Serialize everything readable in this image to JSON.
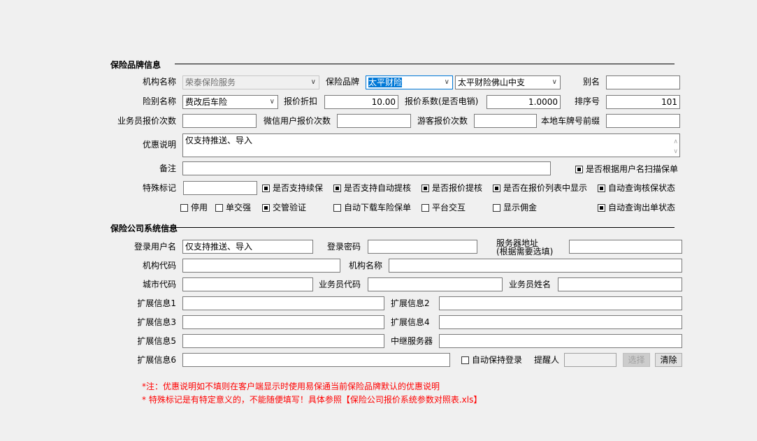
{
  "brand_section": {
    "title": "保险品牌信息",
    "org_name_label": "机构名称",
    "org_name_value": "荣泰保险服务",
    "brand_label": "保险品牌",
    "brand_value": "太平财险",
    "branch_value": "太平财险佛山中支",
    "alias_label": "别名",
    "alias_value": "",
    "insurance_type_label": "险别名称",
    "insurance_type_value": "费改后车险",
    "discount_label": "报价折扣",
    "discount_value": "10.00",
    "coef_label": "报价系数(是否电销)",
    "coef_value": "1.0000",
    "sort_label": "排序号",
    "sort_value": "101",
    "agent_count_label": "业务员报价次数",
    "wechat_count_label": "微信用户报价次数",
    "guest_count_label": "游客报价次数",
    "plate_prefix_label": "本地车牌号前缀",
    "promo_label": "优惠说明",
    "promo_value": "仅支持推送、导入",
    "remark_label": "备注",
    "special_label": "特殊标记",
    "checkboxes": [
      {
        "label": "是否根据用户名扫描保单",
        "checked": true
      },
      {
        "label": "是否支持续保",
        "checked": true
      },
      {
        "label": "是否支持自动提核",
        "checked": true
      },
      {
        "label": "是否报价提核",
        "checked": true
      },
      {
        "label": "是否在报价列表中显示",
        "checked": true
      },
      {
        "label": "自动查询核保状态",
        "checked": true
      },
      {
        "label": "停用",
        "checked": false
      },
      {
        "label": "单交强",
        "checked": false
      },
      {
        "label": "交管验证",
        "checked": true
      },
      {
        "label": "自动下载车险保单",
        "checked": false
      },
      {
        "label": "平台交互",
        "checked": false
      },
      {
        "label": "显示佣金",
        "checked": false
      },
      {
        "label": "自动查询出单状态",
        "checked": true
      }
    ]
  },
  "system_section": {
    "title": "保险公司系统信息",
    "login_user_label": "登录用户名",
    "login_user_value": "仅支持推送、导入",
    "login_pwd_label": "登录密码",
    "server_label_1": "服务器地址",
    "server_label_2": "(根据需要选填)",
    "org_code_label": "机构代码",
    "org_name_label": "机构名称",
    "city_code_label": "城市代码",
    "agent_code_label": "业务员代码",
    "agent_name_label": "业务员姓名",
    "ext1": "扩展信息1",
    "ext2": "扩展信息2",
    "ext3": "扩展信息3",
    "ext4": "扩展信息4",
    "ext5": "扩展信息5",
    "relay_label": "中继服务器",
    "ext6": "扩展信息6",
    "keep_login_label": "自动保持登录",
    "keep_login_checked": false,
    "reminder_label": "提醒人",
    "select_button": "选择",
    "clear_button": "清除"
  },
  "notes": [
    "*注：优惠说明如不填则在客户端显示时使用易保通当前保险品牌默认的优惠说明",
    "* 特殊标记是有特定意义的，不能随便填写！具体参照【保险公司报价系统参数对照表.xls】"
  ]
}
